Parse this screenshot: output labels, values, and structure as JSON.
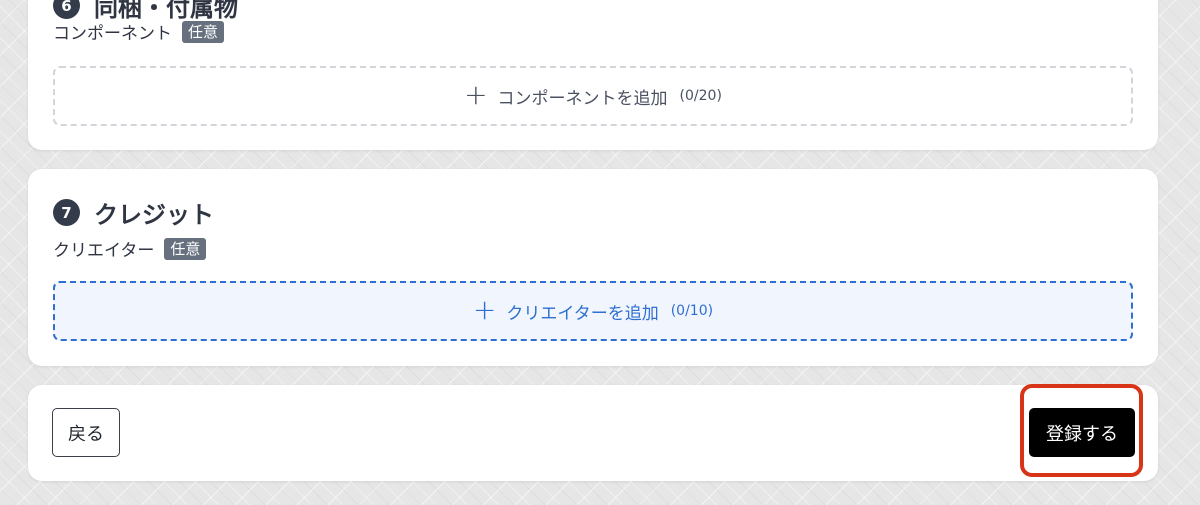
{
  "components_section": {
    "step": "6",
    "title": "同梱・付属物",
    "field_label": "コンポーネント",
    "optional_badge": "任意",
    "add_button": {
      "plus": "+",
      "label": "コンポーネントを追加",
      "count": "(0/20)"
    }
  },
  "credits_section": {
    "step": "7",
    "title": "クレジット",
    "field_label": "クリエイター",
    "optional_badge": "任意",
    "add_button": {
      "plus": "+",
      "label": "クリエイターを追加",
      "count": "(0/10)"
    }
  },
  "actions": {
    "back_label": "戻る",
    "submit_label": "登録する"
  },
  "colors": {
    "accent_blue": "#2e6fd1",
    "highlight_red": "#d73418",
    "badge_gray": "#66707f",
    "step_badge": "#343b4a"
  }
}
